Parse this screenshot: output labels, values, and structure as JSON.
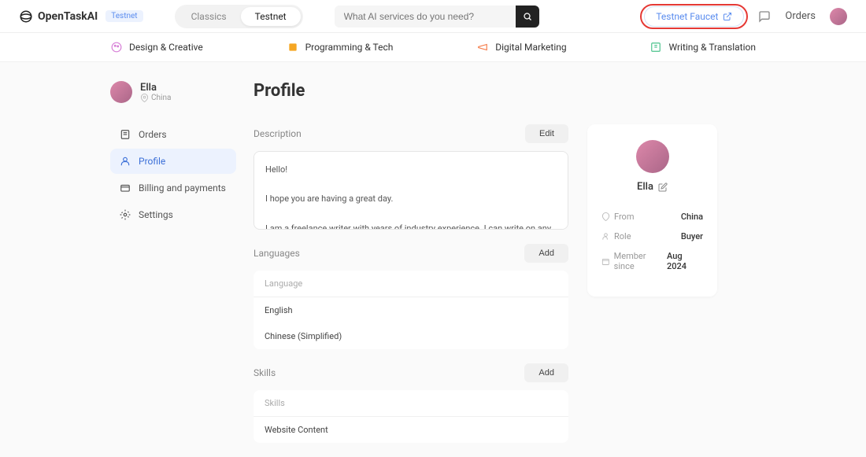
{
  "header": {
    "logo": "OpenTaskAI",
    "badge": "Testnet",
    "tabs": {
      "classics": "Classics",
      "testnet": "Testnet"
    },
    "search_placeholder": "What AI services do you need?",
    "faucet": "Testnet Faucet",
    "orders": "Orders"
  },
  "categories": {
    "design": "Design & Creative",
    "programming": "Programming & Tech",
    "marketing": "Digital Marketing",
    "writing": "Writing & Translation"
  },
  "sidebar": {
    "user": {
      "name": "Ella",
      "location": "China"
    },
    "nav": {
      "orders": "Orders",
      "profile": "Profile",
      "billing": "Billing and payments",
      "settings": "Settings"
    }
  },
  "page": {
    "title": "Profile",
    "description": {
      "label": "Description",
      "edit": "Edit",
      "text_l1": "Hello!",
      "text_l2": "I hope you are having a great day.",
      "text_l3": "I am a freelance writer with years of industry experience. I can write on any topic you wish. For the past few years, I have been writing with Surfe SEO and Jasper AI to create human-readable"
    },
    "languages": {
      "label": "Languages",
      "add": "Add",
      "header": "Language",
      "items": [
        "English",
        "Chinese (Simplified)"
      ]
    },
    "skills": {
      "label": "Skills",
      "add": "Add",
      "header": "Skills",
      "items": [
        "Website Content"
      ]
    }
  },
  "card": {
    "name": "Ella",
    "from_label": "From",
    "from_value": "China",
    "role_label": "Role",
    "role_value": "Buyer",
    "member_label": "Member since",
    "member_value": "Aug 2024"
  }
}
